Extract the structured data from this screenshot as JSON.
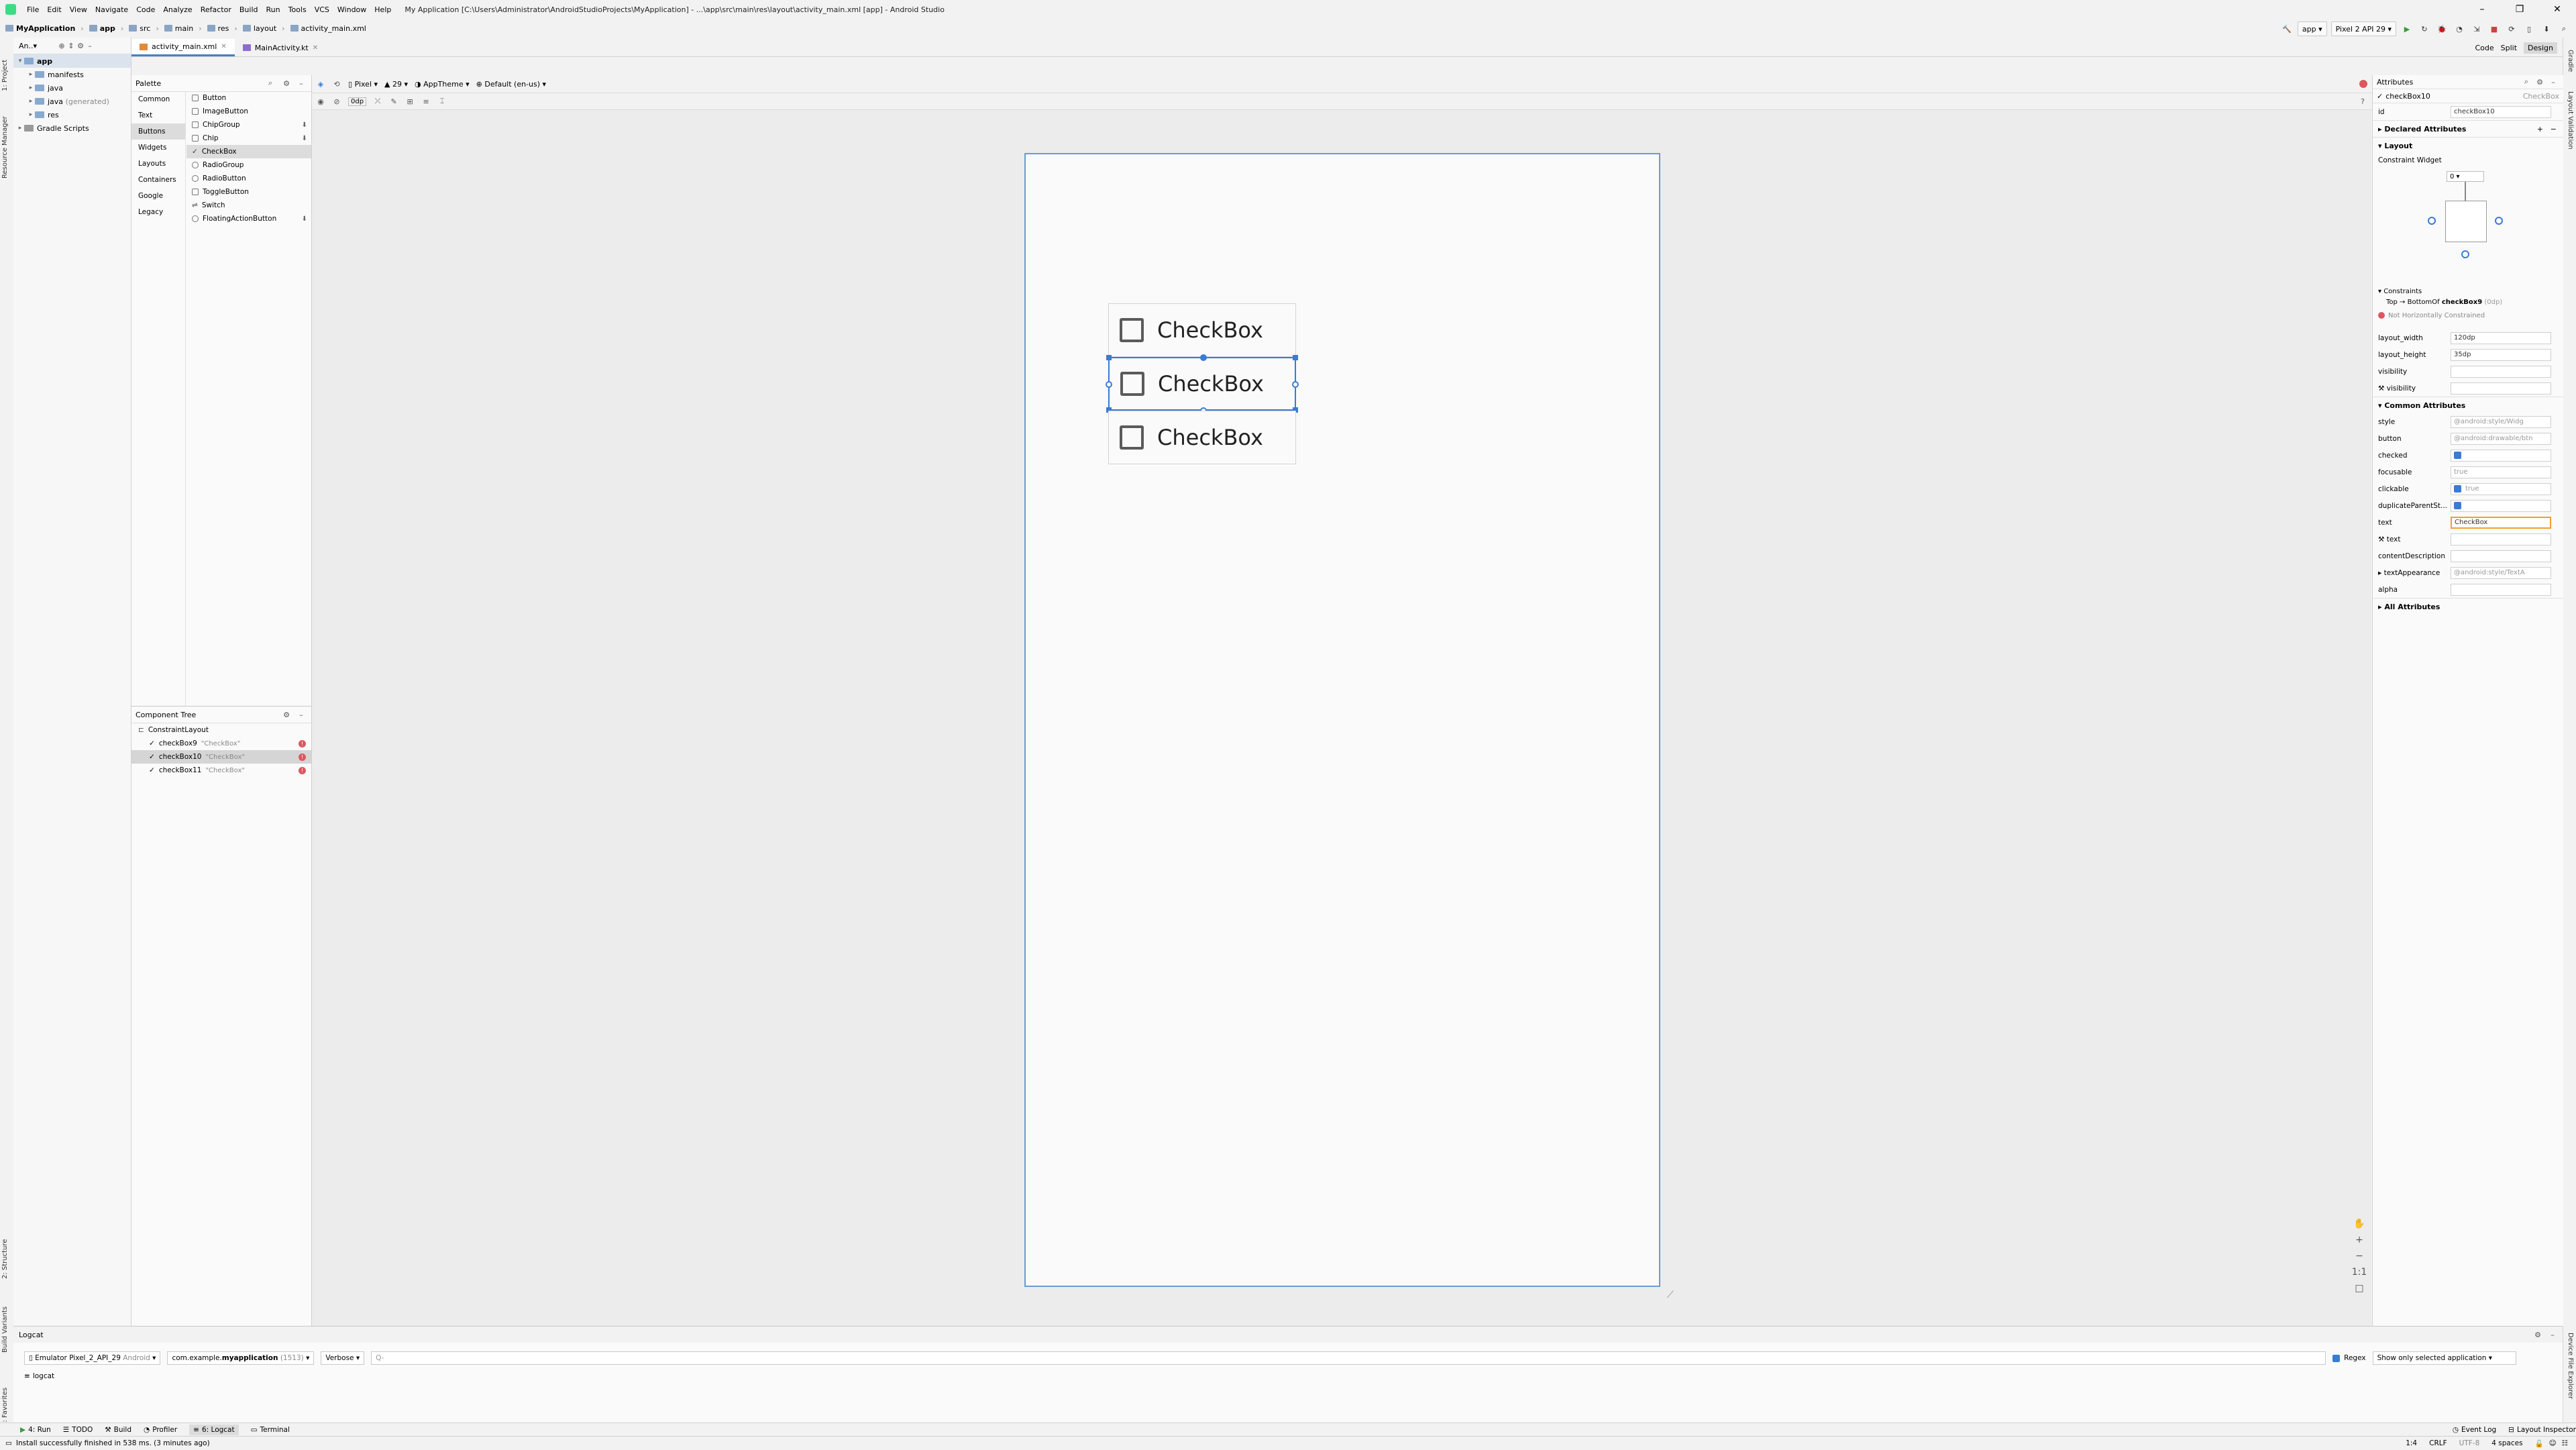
{
  "menubar": {
    "items": [
      "File",
      "Edit",
      "View",
      "Navigate",
      "Code",
      "Analyze",
      "Refactor",
      "Build",
      "Run",
      "Tools",
      "VCS",
      "Window",
      "Help"
    ],
    "title": "My Application [C:\\Users\\Administrator\\AndroidStudioProjects\\MyApplication] - ...\\app\\src\\main\\res\\layout\\activity_main.xml [app] - Android Studio"
  },
  "breadcrumbs": [
    "MyApplication",
    "app",
    "src",
    "main",
    "res",
    "layout",
    "activity_main.xml"
  ],
  "toolbar": {
    "run_config": "app",
    "device": "Pixel 2 API 29"
  },
  "left_tool_tabs": [
    "1: Project",
    "Resource Manager",
    "2: Structure",
    "Build Variants",
    "2: Favorites"
  ],
  "right_tool_tabs": [
    "Gradle",
    "Layout Validation",
    "Device File Explorer"
  ],
  "project": {
    "header": "An..▾",
    "tree": [
      {
        "label": "app",
        "level": 0,
        "arrow": "▾"
      },
      {
        "label": "manifests",
        "level": 1,
        "arrow": "▸"
      },
      {
        "label": "java",
        "level": 1,
        "arrow": "▸"
      },
      {
        "label": "java",
        "suffix": "(generated)",
        "level": 1,
        "arrow": "▸"
      },
      {
        "label": "res",
        "level": 1,
        "arrow": "▸"
      },
      {
        "label": "Gradle Scripts",
        "level": 0,
        "arrow": "▸"
      }
    ]
  },
  "editor_tabs": [
    {
      "label": "activity_main.xml",
      "active": true
    },
    {
      "label": "MainActivity.kt",
      "active": false
    }
  ],
  "view_modes": [
    "Code",
    "Split",
    "Design"
  ],
  "palette": {
    "title": "Palette",
    "categories": [
      "Common",
      "Text",
      "Buttons",
      "Widgets",
      "Layouts",
      "Containers",
      "Google",
      "Legacy"
    ],
    "selected_category": "Buttons",
    "items": [
      "Button",
      "ImageButton",
      "ChipGroup",
      "Chip",
      "CheckBox",
      "RadioGroup",
      "RadioButton",
      "ToggleButton",
      "Switch",
      "FloatingActionButton"
    ],
    "selected_item": "CheckBox"
  },
  "component_tree": {
    "title": "Component Tree",
    "root": "ConstraintLayout",
    "children": [
      {
        "id": "checkBox9",
        "text": "\"CheckBox\"",
        "selected": false
      },
      {
        "id": "checkBox10",
        "text": "\"CheckBox\"",
        "selected": true
      },
      {
        "id": "checkBox11",
        "text": "\"CheckBox\"",
        "selected": false
      }
    ]
  },
  "design_toolbar": {
    "device": "Pixel",
    "api": "29",
    "theme": "AppTheme",
    "locale": "Default (en-us)",
    "margin": "0dp"
  },
  "canvas": {
    "checkboxes": [
      {
        "label": "CheckBox",
        "selected": false
      },
      {
        "label": "CheckBox",
        "selected": true
      },
      {
        "label": "CheckBox",
        "selected": false
      }
    ]
  },
  "attributes": {
    "title": "Attributes",
    "selected_id": "checkBox10",
    "selected_type": "CheckBox",
    "id": "checkBox10",
    "declared_title": "Declared Attributes",
    "layout_title": "Layout",
    "constraint_widget": "Constraint Widget",
    "constraint_top": "0",
    "constraints_label": "Constraints",
    "constraint_rule_pre": "Top → BottomOf",
    "constraint_rule_target": "checkBox9",
    "constraint_rule_post": "(0dp)",
    "not_constrained": "Not Horizontally Constrained",
    "layout_rows": [
      {
        "k": "layout_width",
        "v": "120dp"
      },
      {
        "k": "layout_height",
        "v": "35dp"
      },
      {
        "k": "visibility",
        "v": ""
      },
      {
        "k": "visibility",
        "v": ""
      }
    ],
    "common_title": "Common Attributes",
    "common_rows": [
      {
        "k": "style",
        "v": "@android:style/Widg"
      },
      {
        "k": "button",
        "v": "@android:drawable/btn"
      },
      {
        "k": "checked",
        "v": ""
      },
      {
        "k": "focusable",
        "v": "true"
      },
      {
        "k": "clickable",
        "v": "true"
      },
      {
        "k": "duplicateParentSt...",
        "v": ""
      },
      {
        "k": "text",
        "v": "CheckBox"
      },
      {
        "k": "text",
        "v": ""
      },
      {
        "k": "contentDescription",
        "v": ""
      },
      {
        "k": "textAppearance",
        "v": "@android:style/TextA"
      },
      {
        "k": "alpha",
        "v": ""
      }
    ],
    "all_title": "All Attributes"
  },
  "logcat": {
    "title": "Logcat",
    "device": "Emulator Pixel_2_API_29",
    "device_suffix": "Android",
    "package_pre": "com.example.",
    "package_bold": "myapplication",
    "package_pid": "(1513)",
    "level": "Verbose",
    "search_placeholder": "Q-",
    "regex": "Regex",
    "filter": "Show only selected application",
    "tab": "logcat"
  },
  "bottom_tabs": [
    "4: Run",
    "TODO",
    "Build",
    "Profiler",
    "6: Logcat",
    "Terminal"
  ],
  "bottom_right_tabs": [
    "Event Log",
    "Layout Inspector"
  ],
  "status": {
    "message": "Install successfully finished in 538 ms. (3 minutes ago)",
    "position": "1:4",
    "line_sep": "CRLF",
    "encoding": "UTF-8",
    "indent": "4 spaces"
  }
}
